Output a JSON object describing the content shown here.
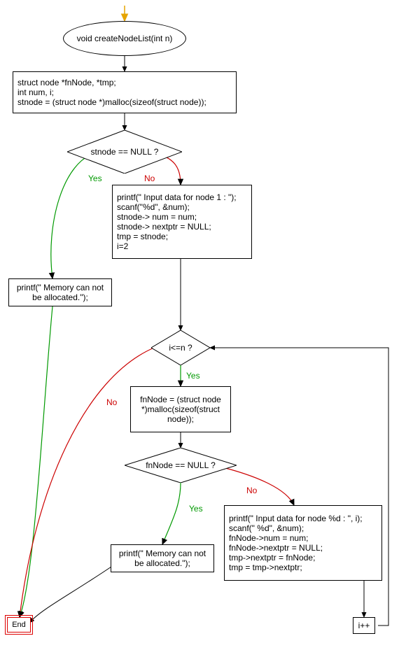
{
  "chart_data": {
    "type": "flowchart",
    "title": "",
    "nodes": [
      {
        "id": "start",
        "shape": "terminator",
        "text": "void createNodeList(int n)"
      },
      {
        "id": "declare",
        "shape": "process",
        "text": "struct node *fnNode, *tmp;\nint num, i;\nstnode = (struct node *)malloc(sizeof(struct node));"
      },
      {
        "id": "stnode_null",
        "shape": "decision",
        "text": "stnode == NULL ?"
      },
      {
        "id": "init_first",
        "shape": "process",
        "text": "printf(\" Input data for node 1 : \");\nscanf(\"%d\", &num);\nstnode-> num = num;\nstnode-> nextptr = NULL;\ntmp = stnode;\ni=2"
      },
      {
        "id": "mem_fail_1",
        "shape": "process",
        "text": "printf(\" Memory can not be allocated.\");"
      },
      {
        "id": "loop_cond",
        "shape": "decision",
        "text": "i<=n ?"
      },
      {
        "id": "alloc_fn",
        "shape": "process",
        "text": "fnNode = (struct node *)malloc(sizeof(struct node));"
      },
      {
        "id": "fn_null",
        "shape": "decision",
        "text": "fnNode == NULL ?"
      },
      {
        "id": "mem_fail_2",
        "shape": "process",
        "text": "printf(\" Memory can not be allocated.\");"
      },
      {
        "id": "fill_fn",
        "shape": "process",
        "text": "printf(\" Input data for node %d : \", i);\nscanf(\" %d\", &num);\nfnNode->num = num;\nfnNode->nextptr = NULL;\ntmp->nextptr = fnNode;\ntmp = tmp->nextptr;"
      },
      {
        "id": "incr",
        "shape": "process",
        "text": "i++"
      },
      {
        "id": "end",
        "shape": "terminator",
        "text": "End"
      }
    ],
    "edges": [
      {
        "from": "start",
        "to": "declare"
      },
      {
        "from": "declare",
        "to": "stnode_null"
      },
      {
        "from": "stnode_null",
        "to": "mem_fail_1",
        "label": "Yes"
      },
      {
        "from": "stnode_null",
        "to": "init_first",
        "label": "No"
      },
      {
        "from": "init_first",
        "to": "loop_cond"
      },
      {
        "from": "loop_cond",
        "to": "alloc_fn",
        "label": "Yes"
      },
      {
        "from": "loop_cond",
        "to": "end",
        "label": "No"
      },
      {
        "from": "alloc_fn",
        "to": "fn_null"
      },
      {
        "from": "fn_null",
        "to": "mem_fail_2",
        "label": "Yes"
      },
      {
        "from": "fn_null",
        "to": "fill_fn",
        "label": "No"
      },
      {
        "from": "fill_fn",
        "to": "incr"
      },
      {
        "from": "incr",
        "to": "loop_cond"
      },
      {
        "from": "mem_fail_1",
        "to": "end"
      },
      {
        "from": "mem_fail_2",
        "to": "end"
      }
    ]
  },
  "labels": {
    "yes": "Yes",
    "no": "No"
  }
}
